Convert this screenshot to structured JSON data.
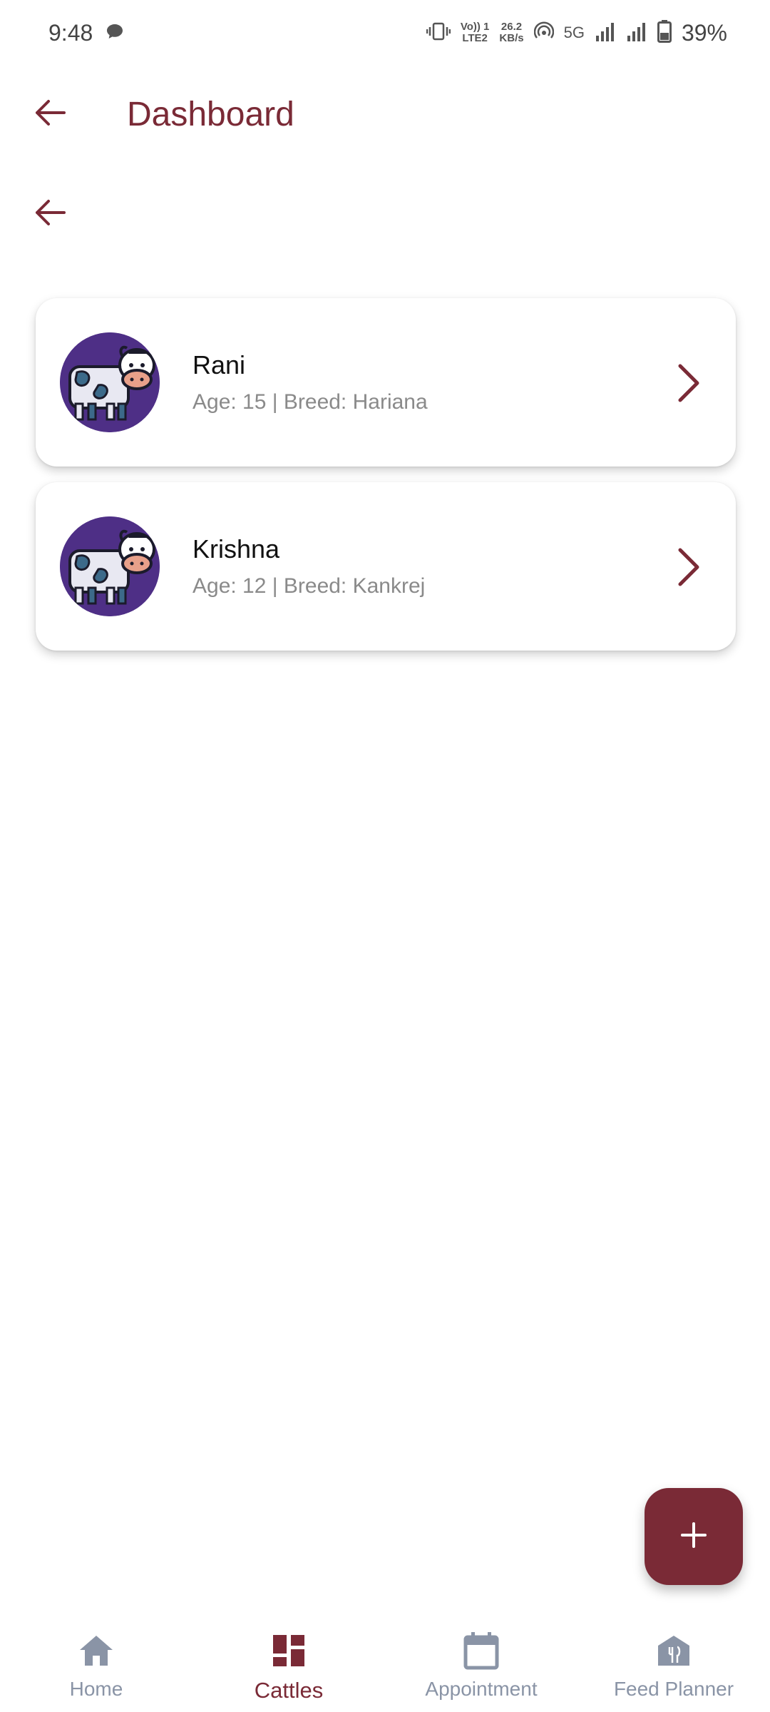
{
  "status_bar": {
    "time": "9:48",
    "volte": "Vo)) 1\nLTE2",
    "speed": "26.2\nKB/s",
    "network": "5G",
    "battery": "39%"
  },
  "app_bar": {
    "title": "Dashboard"
  },
  "cattle": [
    {
      "name": "Rani",
      "details": "Age: 15 | Breed: Hariana"
    },
    {
      "name": "Krishna",
      "details": "Age: 12 | Breed: Kankrej"
    }
  ],
  "bottom_nav": {
    "items": [
      {
        "label": "Home",
        "icon": "home-icon"
      },
      {
        "label": "Cattles",
        "icon": "dashboard-grid-icon",
        "active": true
      },
      {
        "label": "Appointment",
        "icon": "calendar-icon"
      },
      {
        "label": "Feed Planner",
        "icon": "restaurant-icon"
      }
    ]
  },
  "colors": {
    "primary": "#7a2a36",
    "avatar_bg": "#4e2f86",
    "nav_inactive": "#8a94a6"
  }
}
